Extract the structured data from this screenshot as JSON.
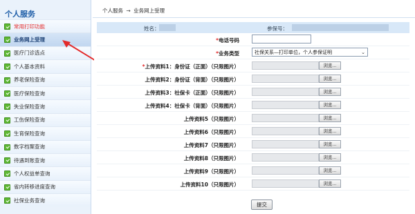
{
  "sidebar": {
    "title": "个人服务",
    "items": [
      {
        "label": "常用打印功能",
        "style": "red"
      },
      {
        "label": "业务网上受理",
        "style": "selected"
      },
      {
        "label": "医疗门诊选点",
        "style": "normal"
      },
      {
        "label": "个人基本资料",
        "style": "normal"
      },
      {
        "label": "养老保险查询",
        "style": "normal"
      },
      {
        "label": "医疗保险查询",
        "style": "normal"
      },
      {
        "label": "失业保险查询",
        "style": "normal"
      },
      {
        "label": "工伤保险查询",
        "style": "normal"
      },
      {
        "label": "生育保险查询",
        "style": "normal"
      },
      {
        "label": "数字档案查询",
        "style": "normal"
      },
      {
        "label": "待遇到账查询",
        "style": "normal"
      },
      {
        "label": "个人权益单查询",
        "style": "normal"
      },
      {
        "label": "省内转移进度查询",
        "style": "normal"
      },
      {
        "label": "社保业务查询",
        "style": "normal"
      }
    ]
  },
  "breadcrumb": {
    "part1": "个人服务",
    "sep": "→",
    "part2": "业务网上受理"
  },
  "info": {
    "name_label": "姓名：",
    "insured_label": "参保号："
  },
  "form": {
    "phone_label": "电话号码",
    "business_type_label": "业务类型",
    "business_type_value": "社保关系—打印单位，个人参保证明",
    "browse_label": "浏览...",
    "uploads": [
      {
        "label": "上传资料1：身份证（正面）（只限图片）",
        "required": true
      },
      {
        "label": "上传资料2：身份证（背面）（只限图片）",
        "required": false
      },
      {
        "label": "上传资料3：社保卡（正面）（只限图片）",
        "required": false
      },
      {
        "label": "上传资料4：社保卡（背面）（只限图片）",
        "required": false
      },
      {
        "label": "上传资料5（只限图片）",
        "required": false
      },
      {
        "label": "上传资料6（只限图片）",
        "required": false
      },
      {
        "label": "上传资料7（只限图片）",
        "required": false
      },
      {
        "label": "上传资料8（只限图片）",
        "required": false
      },
      {
        "label": "上传资料9（只限图片）",
        "required": false
      },
      {
        "label": "上传资料10（只限图片）",
        "required": false
      }
    ],
    "submit_label": "提交"
  },
  "colors": {
    "accent": "#1f5ea8",
    "sidebar_bg": "#eaf2fb",
    "annotation_arrow": "#e32a2a",
    "check_green": "#5fb934"
  }
}
